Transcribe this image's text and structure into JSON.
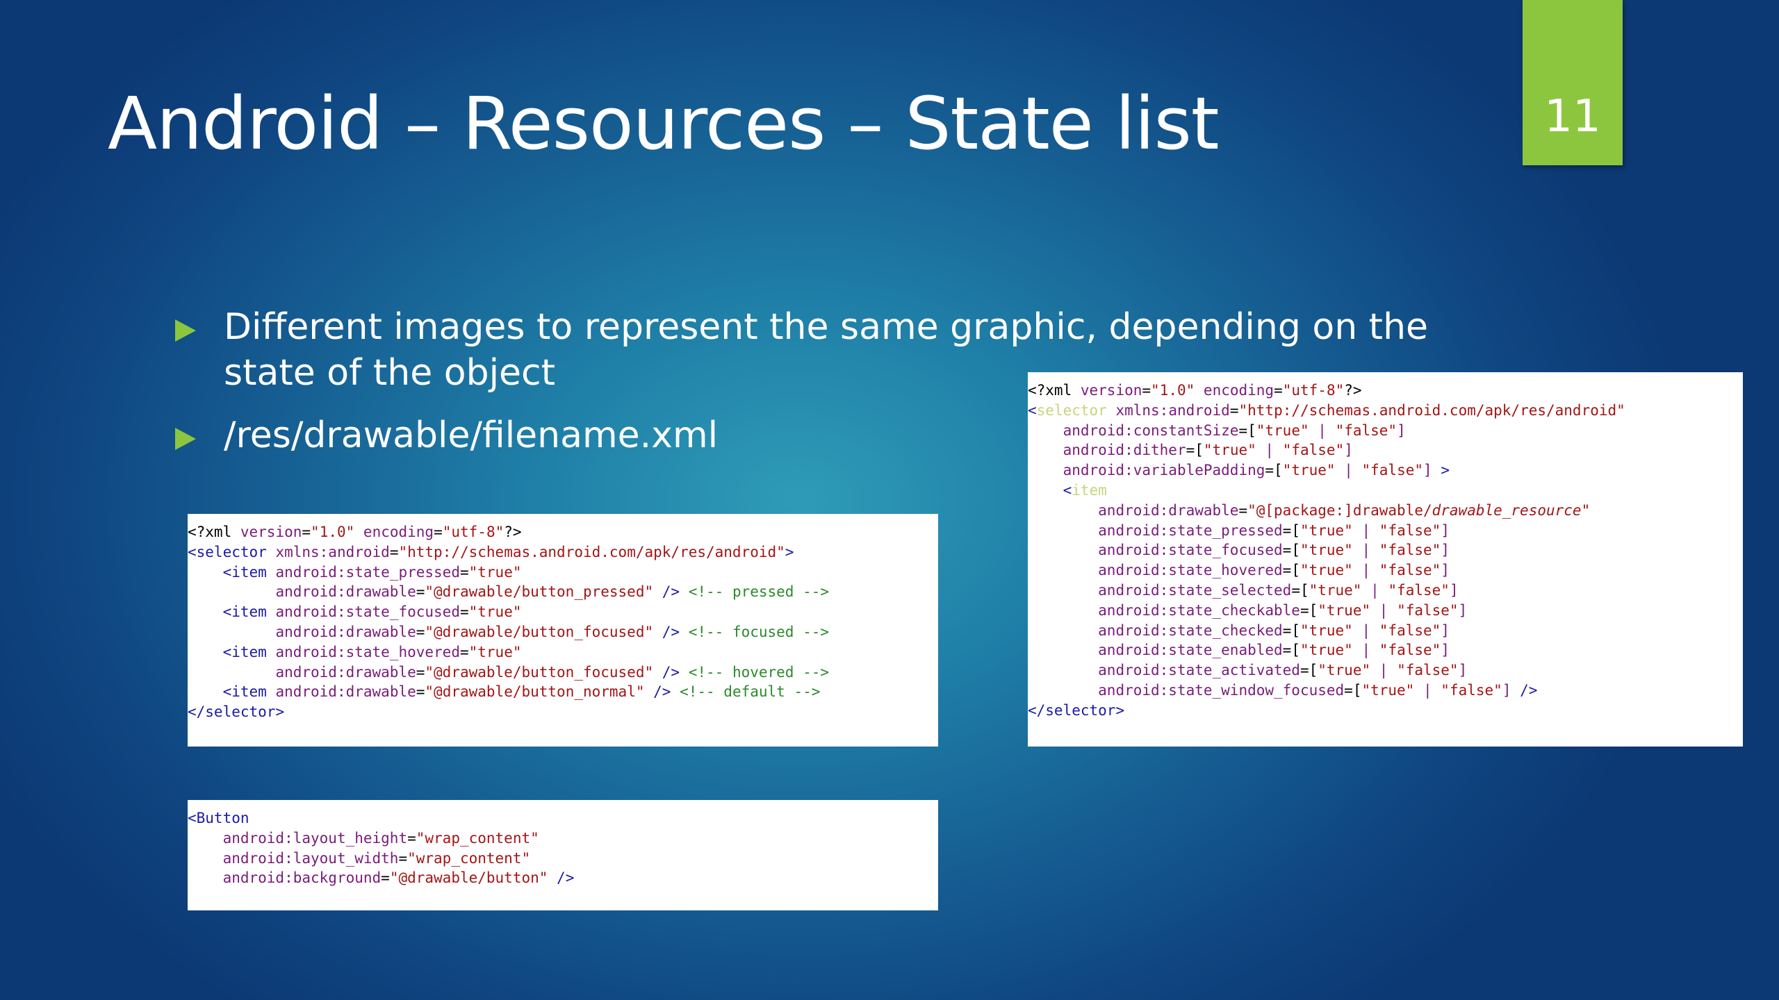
{
  "title": "Android – Resources – State list",
  "page_number": "11",
  "colors": {
    "accent": "#8cc63e",
    "background": "#1f7fa7",
    "code_tag": "#1a1aa6",
    "code_attr": "#7a1c7a",
    "code_value": "#a31515",
    "code_comment": "#2a8a2a"
  },
  "bullets": [
    {
      "text": "Different images to represent the same graphic, depending on the state of the object",
      "icon": "triangle-bullet-icon"
    },
    {
      "text": "/res/drawable/filename.xml",
      "icon": "triangle-bullet-icon"
    }
  ],
  "code_example_selector": {
    "lines": [
      "<?xml version=\"1.0\" encoding=\"utf-8\"?>",
      "<selector xmlns:android=\"http://schemas.android.com/apk/res/android\">",
      "    <item android:state_pressed=\"true\"",
      "          android:drawable=\"@drawable/button_pressed\" /> <!-- pressed -->",
      "    <item android:state_focused=\"true\"",
      "          android:drawable=\"@drawable/button_focused\" /> <!-- focused -->",
      "    <item android:state_hovered=\"true\"",
      "          android:drawable=\"@drawable/button_focused\" /> <!-- hovered -->",
      "    <item android:drawable=\"@drawable/button_normal\" /> <!-- default -->",
      "</selector>"
    ]
  },
  "code_example_button": {
    "lines": [
      "<Button",
      "    android:layout_height=\"wrap_content\"",
      "    android:layout_width=\"wrap_content\"",
      "    android:background=\"@drawable/button\" />"
    ]
  },
  "code_syntax": {
    "lines": [
      "<?xml version=\"1.0\" encoding=\"utf-8\"?>",
      "<selector xmlns:android=\"http://schemas.android.com/apk/res/android\"",
      "    android:constantSize=[\"true\" | \"false\"]",
      "    android:dither=[\"true\" | \"false\"]",
      "    android:variablePadding=[\"true\" | \"false\"] >",
      "    <item",
      "        android:drawable=\"@[package:]drawable/drawable_resource\"",
      "        android:state_pressed=[\"true\" | \"false\"]",
      "        android:state_focused=[\"true\" | \"false\"]",
      "        android:state_hovered=[\"true\" | \"false\"]",
      "        android:state_selected=[\"true\" | \"false\"]",
      "        android:state_checkable=[\"true\" | \"false\"]",
      "        android:state_checked=[\"true\" | \"false\"]",
      "        android:state_enabled=[\"true\" | \"false\"]",
      "        android:state_activated=[\"true\" | \"false\"]",
      "        android:state_window_focused=[\"true\" | \"false\"] />",
      "</selector>"
    ]
  }
}
